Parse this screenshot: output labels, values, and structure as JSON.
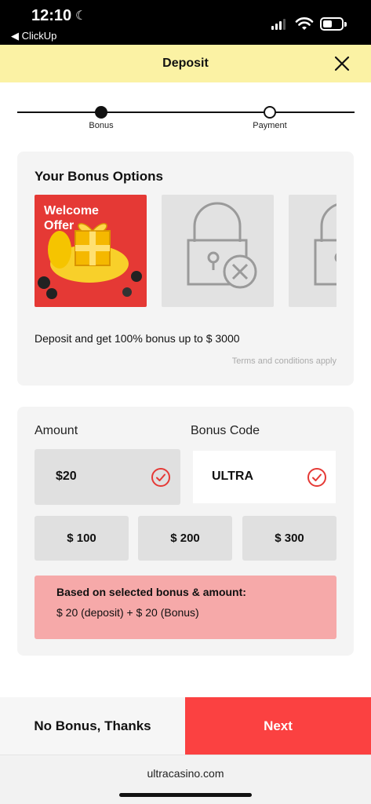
{
  "status_bar": {
    "time": "12:10",
    "back_app": "◀ ClickUp"
  },
  "header": {
    "title": "Deposit"
  },
  "stepper": {
    "steps": [
      {
        "label": "Bonus",
        "active": true
      },
      {
        "label": "Payment",
        "active": false
      }
    ]
  },
  "bonus_options": {
    "title": "Your Bonus Options",
    "welcome_tile_text": "Welcome Offer",
    "description": "Deposit and get 100% bonus up to $ 3000",
    "terms": "Terms and conditions apply"
  },
  "amount": {
    "label": "Amount",
    "selected_value": "$20",
    "options": [
      "$ 100",
      "$ 200",
      "$ 300"
    ]
  },
  "bonus_code": {
    "label": "Bonus Code",
    "value": "ULTRA"
  },
  "summary": {
    "heading": "Based on selected bonus & amount:",
    "text": "$ 20 (deposit) + $ 20 (Bonus)"
  },
  "actions": {
    "no_bonus": "No Bonus, Thanks",
    "next": "Next"
  },
  "browser": {
    "url": "ultracasino.com"
  },
  "colors": {
    "header_bg": "#fbf2a4",
    "next_bg": "#fb4141",
    "summary_bg": "#f6a9a9",
    "check": "#e53935"
  },
  "icons": {
    "close": "close-icon",
    "check": "check-circle-icon",
    "lock": "lock-icon"
  }
}
